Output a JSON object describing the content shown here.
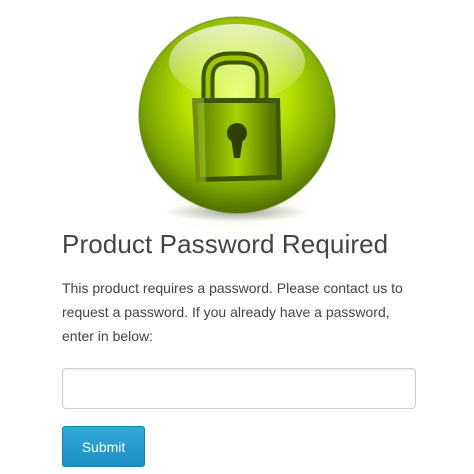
{
  "lock_icon": {
    "icon": "padlock-icon",
    "accent_color": "#9bd000"
  },
  "title": "Product Password Required",
  "message": "This product requires a password. Please contact us to request a password. If you already have a password, enter in below:",
  "password_input": {
    "value": "",
    "placeholder": ""
  },
  "submit_button": {
    "label": "Submit",
    "color": "#2a9fd1"
  }
}
